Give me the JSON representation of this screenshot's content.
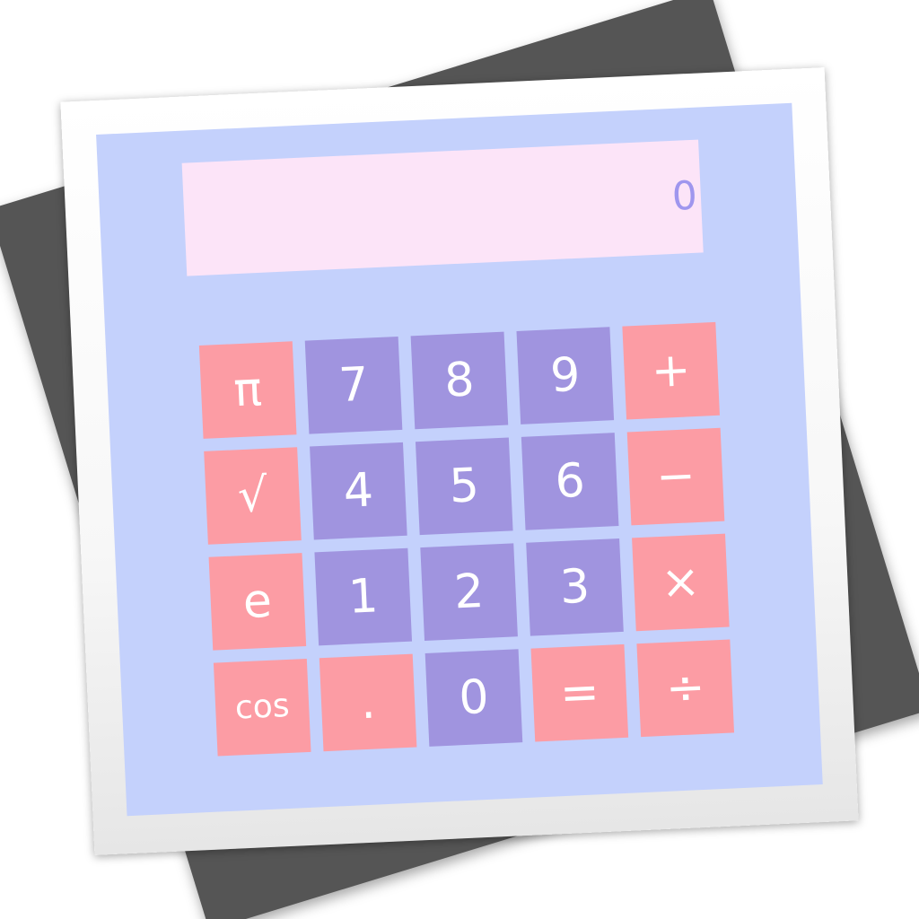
{
  "colors": {
    "face": "#c4d1fc",
    "display_bg": "#fce4f8",
    "display_text": "#9f96ee",
    "digit_key": "#a094df",
    "function_key": "#fc9ca4",
    "key_text": "#ffffff"
  },
  "display": {
    "value": "0"
  },
  "keypad": {
    "rows": [
      [
        {
          "label": "π",
          "kind": "function",
          "name": "key-pi"
        },
        {
          "label": "7",
          "kind": "digit",
          "name": "key-7"
        },
        {
          "label": "8",
          "kind": "digit",
          "name": "key-8"
        },
        {
          "label": "9",
          "kind": "digit",
          "name": "key-9"
        },
        {
          "label": "+",
          "kind": "function",
          "name": "key-plus"
        }
      ],
      [
        {
          "label": "√",
          "kind": "function",
          "name": "key-sqrt"
        },
        {
          "label": "4",
          "kind": "digit",
          "name": "key-4"
        },
        {
          "label": "5",
          "kind": "digit",
          "name": "key-5"
        },
        {
          "label": "6",
          "kind": "digit",
          "name": "key-6"
        },
        {
          "label": "−",
          "kind": "function",
          "name": "key-minus"
        }
      ],
      [
        {
          "label": "e",
          "kind": "function",
          "name": "key-e"
        },
        {
          "label": "1",
          "kind": "digit",
          "name": "key-1"
        },
        {
          "label": "2",
          "kind": "digit",
          "name": "key-2"
        },
        {
          "label": "3",
          "kind": "digit",
          "name": "key-3"
        },
        {
          "label": "×",
          "kind": "function",
          "name": "key-multiply"
        }
      ],
      [
        {
          "label": "cos",
          "kind": "function",
          "name": "key-cos"
        },
        {
          "label": ".",
          "kind": "function",
          "name": "key-decimal"
        },
        {
          "label": "0",
          "kind": "digit",
          "name": "key-0"
        },
        {
          "label": "=",
          "kind": "function",
          "name": "key-equals"
        },
        {
          "label": "÷",
          "kind": "function",
          "name": "key-divide"
        }
      ]
    ]
  }
}
